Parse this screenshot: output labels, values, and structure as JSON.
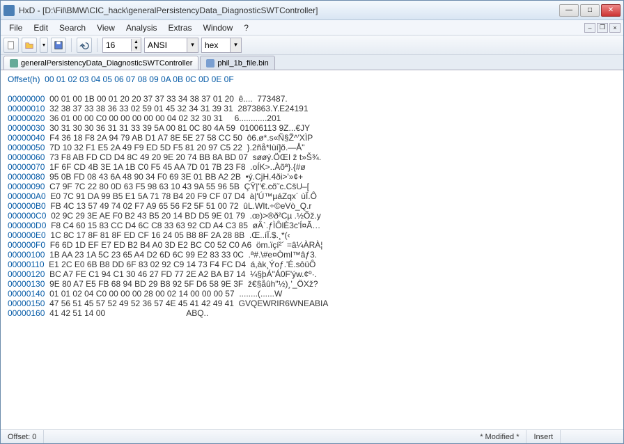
{
  "titlebar": {
    "app": "HxD",
    "path": "[D:\\Fil\\BMW\\CIC_hack\\generalPersistencyData_DiagnosticSWTController]"
  },
  "menu": [
    "File",
    "Edit",
    "Search",
    "View",
    "Analysis",
    "Extras",
    "Window",
    "?"
  ],
  "toolbar": {
    "bytes_per_row": "16",
    "charset": "ANSI",
    "base": "hex"
  },
  "tabs": [
    {
      "label": "generalPersistencyData_DiagnosticSWTController",
      "active": true
    },
    {
      "label": "phil_1b_file.bin",
      "active": false
    }
  ],
  "hex": {
    "offset_label": "Offset(h)",
    "columns": "00 01 02 03 04 05 06 07 08 09 0A 0B 0C 0D 0E 0F",
    "rows": [
      {
        "a": "00000000",
        "b": "00 01 00 1B 00 01 20 20 37 37 33 34 38 37 01 20",
        "t": "ȇ....  773487. "
      },
      {
        "a": "00000010",
        "b": "32 38 37 33 38 36 33 02 59 01 45 32 34 31 39 31",
        "t": "2873863.Y.E24191"
      },
      {
        "a": "00000020",
        "b": "36 01 00 00 C0 00 00 00 00 00 04 02 32 30 31",
        "t": "6............201"
      },
      {
        "a": "00000030",
        "b": "30 31 30 30 36 31 31 33 39 5A 00 81 0C 80 4A 59",
        "t": "01006113 9Z...€JY"
      },
      {
        "a": "00000040",
        "b": "F4 36 18 F8 2A 94 79 AB D1 A7 8E 5E 27 58 CC 50",
        "t": "ô6.ø*.s«Ñ§Ž^'XÌP"
      },
      {
        "a": "00000050",
        "b": "7D 10 32 F1 E5 2A 49 F9 ED 5D F5 81 20 97 C5 22",
        "t": "}.2ñå*Iùí]õ.—Å\""
      },
      {
        "a": "00000060",
        "b": "73 F8 AB FD CD D4 8C 49 20 9E 20 74 BB 8A BD 07",
        "t": "søøý.ÖŒI ž t»Š¾."
      },
      {
        "a": "00000070",
        "b": "1F 6F CD 4B 3E 1A 1B C0 F5 45 AA 7D 01 7B 23 F8",
        "t": ".oÍK>..Àõª}.{#ø"
      },
      {
        "a": "00000080",
        "b": "95 0B FD 08 43 6A 48 90 34 F0 69 3E 01 BB A2 2B",
        "t": "•ý.CjH.4ði>'»¢+"
      },
      {
        "a": "00000090",
        "b": "C7 9F 7C 22 80 0D 63 F5 98 63 10 43 9A 55 96 5B",
        "t": "ÇŸ|\"€.cõ˜c.CšU–["
      },
      {
        "a": "000000A0",
        "b": "E0 7C 91 DA 99 B5 E1 5A 71 78 B4 20 F9 CF 07 D4",
        "t": "à|'Ú™µáZqx´ ùÏ.Ô"
      },
      {
        "a": "000000B0",
        "b": "FB 4C 13 57 49 74 02 F7 A9 65 56 F2 5F 51 00 72",
        "t": "ûL.WIt.÷©eVò_Q.r"
      },
      {
        "a": "000000C0",
        "b": "02 9C 29 3E AE F0 B2 43 B5 20 14 BD D5 9E 01 79",
        "t": ".œ)>®ð²Cµ .½Õž.y"
      },
      {
        "a": "000000D0",
        "b": "F8 C4 60 15 83 CC D4 6C C8 33 63 92 CD A4 C3 85",
        "t": "øÄ`.ƒÌÔlÈ3c'Í¤Ã…"
      },
      {
        "a": "000000E0",
        "b": "1C 8C 17 8F 81 8F ED CF 16 24 05 B8 8F 2A 28 8B",
        "t": ".Œ..íÏ.$.¸*(‹"
      },
      {
        "a": "000000F0",
        "b": "F6 6D 1D EF E7 ED B2 B4 A0 3D E2 BC C0 52 C0 A6",
        "t": "öm.ïçí²´ =â¼ÀRÀ¦"
      },
      {
        "a": "00000100",
        "b": "1B AA 23 1A 5C 23 65 A4 D2 6D 6C 99 E2 83 33 0C",
        "t": ".ª#.\\#e¤Òml™âƒ3."
      },
      {
        "a": "00000110",
        "b": "E1 2C E0 6B B8 DD 6F 83 02 92 C9 14 73 F4 FC D4",
        "t": "á,àk¸Ýoƒ.'É.sôüÔ"
      },
      {
        "a": "00000120",
        "b": "BC A7 FE C1 94 C1 30 46 27 FD 77 2E A2 BA B7 14",
        "t": "¼§þÁ\"Á0F'ýw.¢º·."
      },
      {
        "a": "00000130",
        "b": "9E 80 A7 E5 FB 68 94 BD 29 B8 92 5F D6 58 9E 3F",
        "t": "ž€§åûh\"½)¸'_ÖXž?"
      },
      {
        "a": "00000140",
        "b": "01 01 02 04 C0 00 00 00 28 00 02 14 00 00 00 57",
        "t": "........(......W"
      },
      {
        "a": "00000150",
        "b": "47 56 51 45 57 52 49 52 36 57 4E 45 41 42 49 41",
        "t": "GVQEWRIR6WNEABIA"
      },
      {
        "a": "00000160",
        "b": "41 42 51 14 00",
        "t": "ABQ.."
      }
    ]
  },
  "status": {
    "offset": "Offset: 0",
    "modified": "* Modified *",
    "insert": "Insert"
  }
}
